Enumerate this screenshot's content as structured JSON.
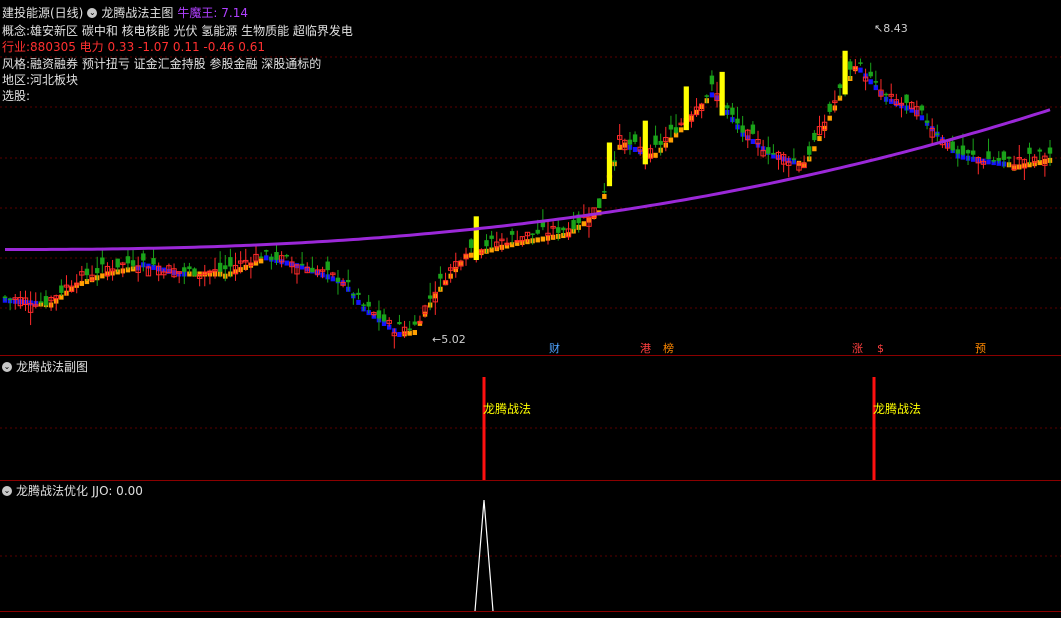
{
  "header": {
    "stock_name": "建投能源(日线)",
    "main_indicator": "龙腾战法主图",
    "extra_label": "牛魔王: 7.14"
  },
  "info": {
    "concept": {
      "label": "概念:",
      "value": "雄安新区 碳中和 核电核能 光伏 氢能源 生物质能 超临界发电"
    },
    "industry": {
      "label": "行业:",
      "value": "880305 电力 0.33 -1.07 0.11 -0.46 0.61"
    },
    "style": {
      "label": "风格:",
      "value": "融资融券 预计扭亏 证金汇金持股 参股金融 深股通标的"
    },
    "region": {
      "label": "地区:",
      "value": "河北板块"
    },
    "pick": {
      "label": "选股:",
      "value": ""
    }
  },
  "annotations": {
    "high": "8.43",
    "low": "5.02"
  },
  "event_badges": [
    {
      "text": "财",
      "color": "#4fa3ff"
    },
    {
      "text": "港",
      "color": "#ff4040"
    },
    {
      "text": "榜",
      "color": "#ff8800"
    },
    {
      "text": "涨",
      "color": "#ff4040"
    },
    {
      "text": "$",
      "color": "#ff4040"
    },
    {
      "text": "预",
      "color": "#ff8800"
    }
  ],
  "sub_panel": {
    "title": "龙腾战法副图",
    "signal_label": "龙腾战法"
  },
  "opt_panel": {
    "title": "龙腾战法优化",
    "value": "JJO: 0.00"
  },
  "colors": {
    "up": "#ff2a2a",
    "down": "#1aa31a",
    "ma_line": "#9b28d8",
    "trend_up": "#ffa000",
    "trend_down": "#1414ff",
    "signal_bar": "#ffff00",
    "divider": "#8b0000",
    "grid": "#5a0000"
  },
  "chart_data": {
    "type": "candlestick",
    "price_range": [
      4.8,
      8.6
    ],
    "labeled_extremes": {
      "high": 8.43,
      "low": 5.02
    },
    "ma_line_start": 5.95,
    "ma_line_end": 7.55,
    "signal_indices": [
      82,
      146
    ],
    "signal_label": "龙腾战法",
    "jjo_value": 0.0
  }
}
